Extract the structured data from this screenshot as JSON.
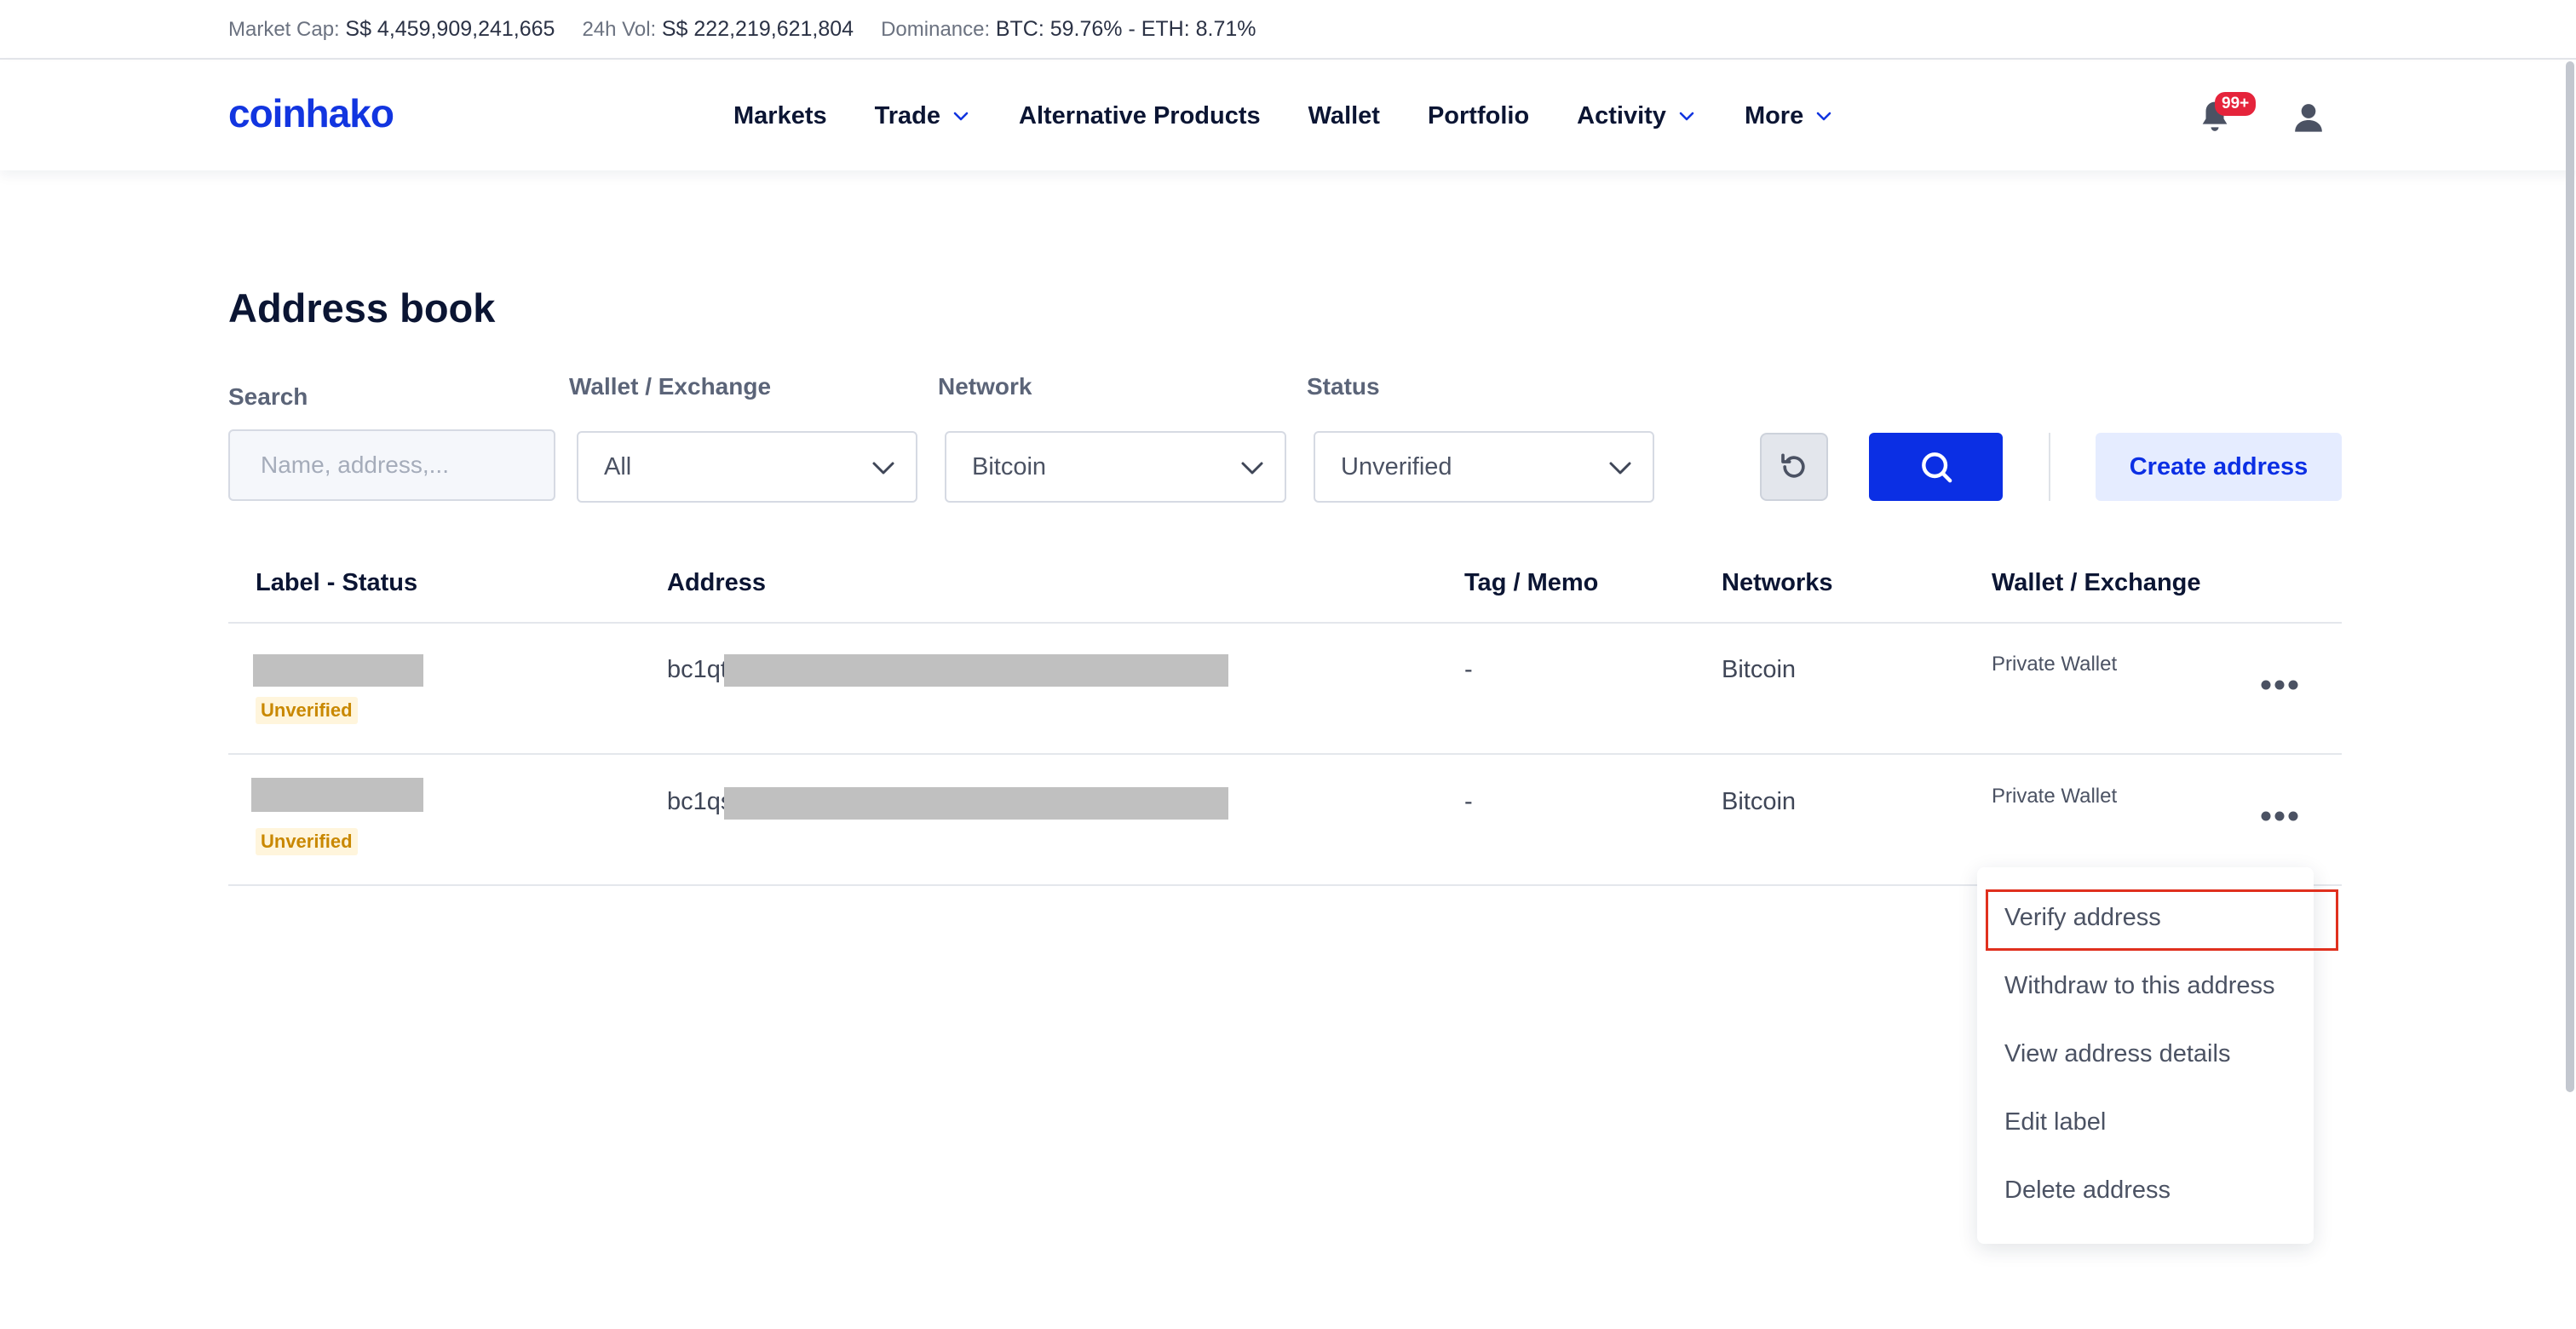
{
  "ticker": {
    "market_cap_label": "Market Cap:",
    "market_cap_value": "S$ 4,459,909,241,665",
    "vol_label": "24h Vol:",
    "vol_value": "S$ 222,219,621,804",
    "dominance_label": "Dominance:",
    "dominance_value": "BTC: 59.76% - ETH: 8.71%"
  },
  "header": {
    "logo": "coinhako",
    "nav": [
      "Markets",
      "Trade",
      "Alternative Products",
      "Wallet",
      "Portfolio",
      "Activity",
      "More"
    ],
    "notification_badge": "99+",
    "icons": [
      "bell-icon",
      "user-icon",
      "chevron-down-icon"
    ]
  },
  "page": {
    "title": "Address book"
  },
  "filters": {
    "search_label": "Search",
    "search_placeholder": "Name, address,...",
    "wallet_label": "Wallet / Exchange",
    "wallet_value": "All",
    "network_label": "Network",
    "network_value": "Bitcoin",
    "status_label": "Status",
    "status_value": "Unverified",
    "create_button": "Create address"
  },
  "table": {
    "headers": [
      "Label - Status",
      "Address",
      "Tag / Memo",
      "Networks",
      "Wallet / Exchange"
    ],
    "rows": [
      {
        "status": "Unverified",
        "address_prefix": "bc1qt",
        "tag": "-",
        "network": "Bitcoin",
        "wallet": "Private Wallet"
      },
      {
        "status": "Unverified",
        "address_prefix": "bc1qs",
        "tag": "-",
        "network": "Bitcoin",
        "wallet": "Private Wallet"
      }
    ]
  },
  "menu": {
    "items": [
      "Verify address",
      "Withdraw to this address",
      "View address details",
      "Edit label",
      "Delete address"
    ],
    "highlighted": "Verify address"
  },
  "colors": {
    "brand": "#1235e0",
    "primary_button": "#0b2fe4",
    "status_unverified": "#c98800",
    "highlight_box": "#e0301e",
    "badge": "#e5243b"
  }
}
